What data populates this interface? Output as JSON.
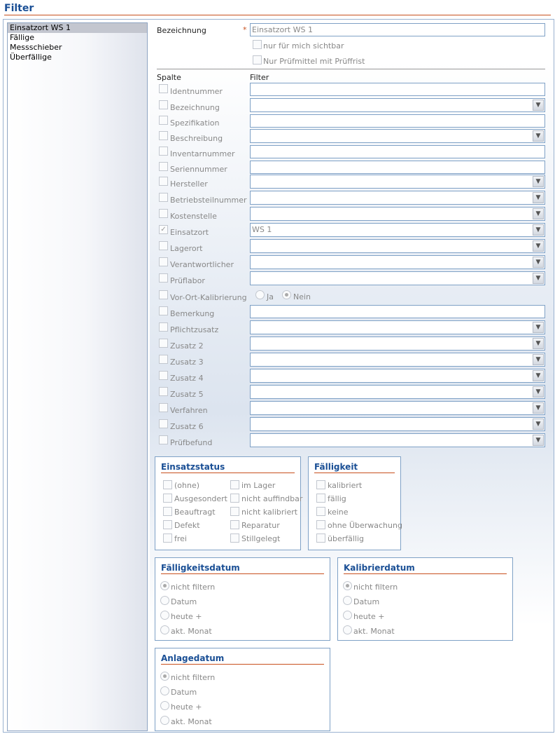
{
  "page": {
    "title": "Filter"
  },
  "sidebar": {
    "items": [
      {
        "label": "Einsatzort WS 1",
        "selected": true
      },
      {
        "label": "Fällige",
        "selected": false
      },
      {
        "label": "Messschieber",
        "selected": false
      },
      {
        "label": "Überfällige",
        "selected": false
      }
    ]
  },
  "form": {
    "bezeichnung_label": "Bezeichnung",
    "required_mark": "*",
    "bezeichnung_value": "Einsatzort WS 1",
    "private_label": "nur für mich sichtbar",
    "pruefrist_label": "Nur Prüfmittel mit Prüffrist",
    "spalte_header": "Spalte",
    "filter_header": "Filter",
    "rows": [
      {
        "label": "Identnummer",
        "type": "text",
        "value": "",
        "checked": false
      },
      {
        "label": "Bezeichnung",
        "type": "select",
        "value": "",
        "checked": false
      },
      {
        "label": "Spezifikation",
        "type": "text",
        "value": "",
        "checked": false
      },
      {
        "label": "Beschreibung",
        "type": "select",
        "value": "",
        "checked": false
      },
      {
        "label": "Inventarnummer",
        "type": "text",
        "value": "",
        "checked": false
      },
      {
        "label": "Seriennummer",
        "type": "text",
        "value": "",
        "checked": false
      },
      {
        "label": "Hersteller",
        "type": "select",
        "value": "",
        "checked": false
      },
      {
        "label": "Betriebsteilnummer",
        "type": "select",
        "value": "",
        "checked": false
      },
      {
        "label": "Kostenstelle",
        "type": "select",
        "value": "",
        "checked": false
      },
      {
        "label": "Einsatzort",
        "type": "select",
        "value": "WS 1",
        "checked": true
      },
      {
        "label": "Lagerort",
        "type": "select",
        "value": "",
        "checked": false
      },
      {
        "label": "Verantwortlicher",
        "type": "select",
        "value": "",
        "checked": false
      },
      {
        "label": "Prüflabor",
        "type": "select",
        "value": "",
        "checked": false
      },
      {
        "label": "Vor-Ort-Kalibrierung",
        "type": "radio",
        "value": "",
        "checked": false
      },
      {
        "label": "Bemerkung",
        "type": "text",
        "value": "",
        "checked": false
      },
      {
        "label": "Pflichtzusatz",
        "type": "select",
        "value": "",
        "checked": false
      },
      {
        "label": "Zusatz 2",
        "type": "select",
        "value": "",
        "checked": false
      },
      {
        "label": "Zusatz 3",
        "type": "select",
        "value": "",
        "checked": false
      },
      {
        "label": "Zusatz 4",
        "type": "select",
        "value": "",
        "checked": false
      },
      {
        "label": "Zusatz 5",
        "type": "select",
        "value": "",
        "checked": false
      },
      {
        "label": "Verfahren",
        "type": "select",
        "value": "",
        "checked": false
      },
      {
        "label": "Zusatz 6",
        "type": "select",
        "value": "",
        "checked": false
      },
      {
        "label": "Prüfbefund",
        "type": "select",
        "value": "",
        "checked": false
      }
    ],
    "vor_ort": {
      "ja_label": "Ja",
      "nein_label": "Nein",
      "selected": "Nein"
    }
  },
  "einsatzstatus": {
    "title": "Einsatzstatus",
    "col1": [
      "(ohne)",
      "Ausgesondert",
      "Beauftragt",
      "Defekt",
      "frei"
    ],
    "col2": [
      "im Lager",
      "nicht auffindbar",
      "nicht kalibriert",
      "Reparatur",
      "Stillgelegt"
    ]
  },
  "faelligkeit": {
    "title": "Fälligkeit",
    "options": [
      "kalibriert",
      "fällig",
      "keine",
      "ohne Überwachung",
      "überfällig"
    ]
  },
  "faelligkeitsdatum": {
    "title": "Fälligkeitsdatum",
    "options": [
      "nicht filtern",
      "Datum",
      "heute +",
      "akt. Monat"
    ],
    "selected": "nicht filtern"
  },
  "kalibrierdatum": {
    "title": "Kalibrierdatum",
    "options": [
      "nicht filtern",
      "Datum",
      "heute +",
      "akt. Monat"
    ],
    "selected": "nicht filtern"
  },
  "anlagedatum": {
    "title": "Anlagedatum",
    "options": [
      "nicht filtern",
      "Datum",
      "heute +",
      "akt. Monat"
    ],
    "selected": "nicht filtern"
  }
}
